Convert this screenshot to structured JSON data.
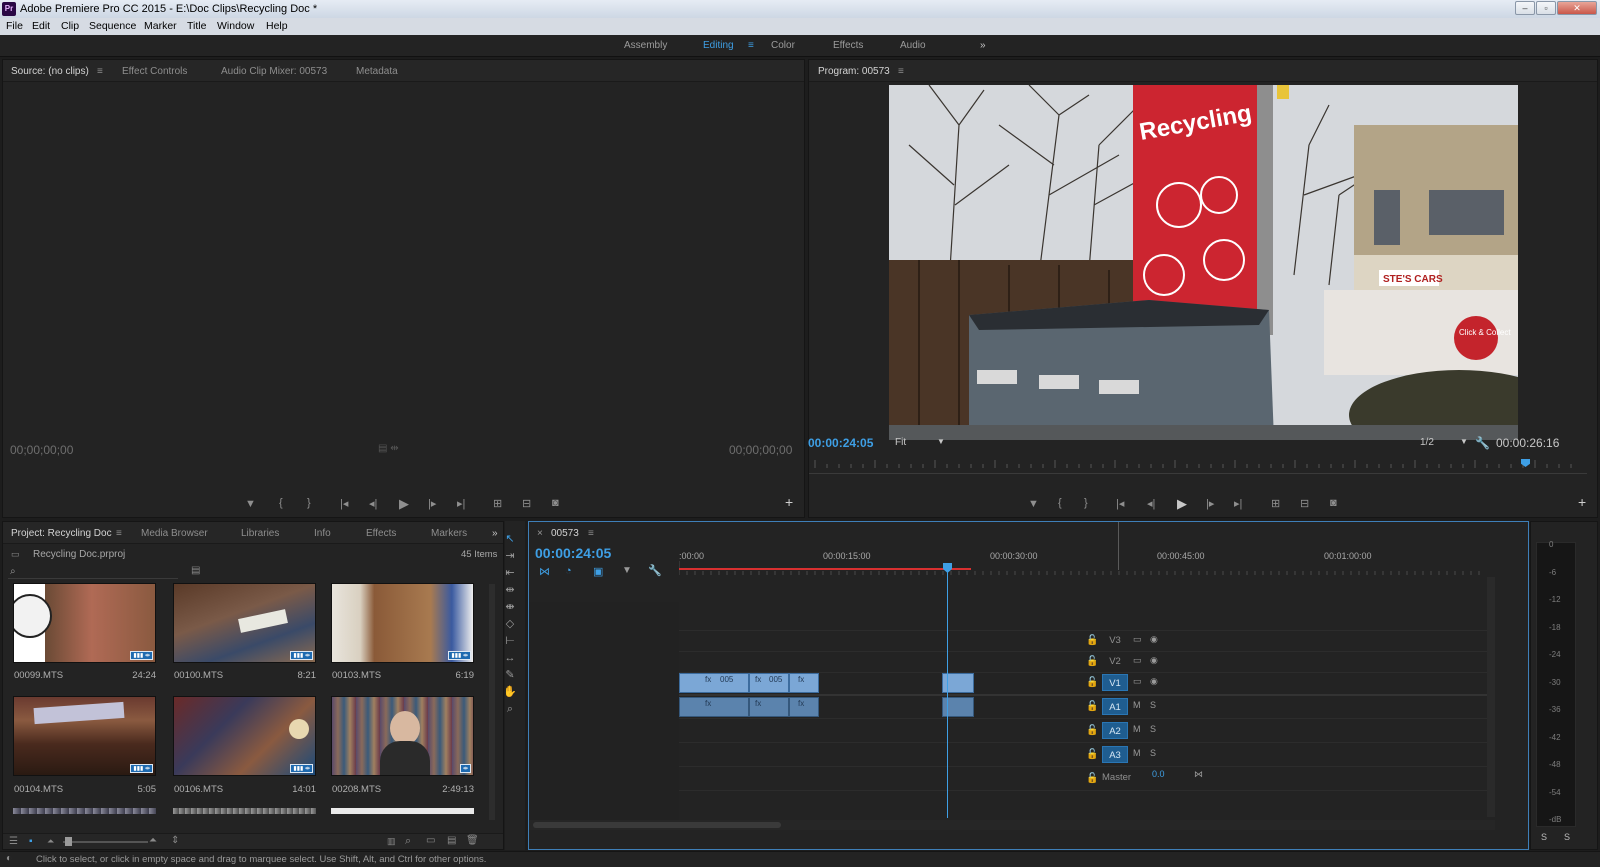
{
  "window": {
    "title": "Adobe Premiere Pro CC 2015 - E:\\Doc Clips\\Recycling Doc *",
    "app_badge": "Pr"
  },
  "menu": [
    "File",
    "Edit",
    "Clip",
    "Sequence",
    "Marker",
    "Title",
    "Window",
    "Help"
  ],
  "workspaces": {
    "items": [
      "Assembly",
      "Editing",
      "Color",
      "Effects",
      "Audio"
    ],
    "active": "Editing",
    "more": "»"
  },
  "source_panel": {
    "tabs": [
      "Source: (no clips)",
      "Effect Controls",
      "Audio Clip Mixer: 00573",
      "Metadata"
    ],
    "timecode_left": "00;00;00;00",
    "timecode_right": "00;00;00;00"
  },
  "program_panel": {
    "tab": "Program: 00573",
    "timecode": "00:00:24:05",
    "zoom": "Fit",
    "resolution": "1/2",
    "duration": "00:00:26:16",
    "sign_text": "Recycling",
    "shop_text": "STE'S CARS",
    "click_collect": "Click & Collect",
    "playhead_fraction": 0.92
  },
  "project_panel": {
    "tabs": [
      "Project: Recycling Doc",
      "Media Browser",
      "Libraries",
      "Info",
      "Effects",
      "Markers"
    ],
    "file": "Recycling Doc.prproj",
    "item_count": "45 Items",
    "clips": [
      {
        "name": "00099.MTS",
        "duration": "24:24"
      },
      {
        "name": "00100.MTS",
        "duration": "8:21"
      },
      {
        "name": "00103.MTS",
        "duration": "6:19"
      },
      {
        "name": "00104.MTS",
        "duration": "5:05"
      },
      {
        "name": "00106.MTS",
        "duration": "14:01"
      },
      {
        "name": "00208.MTS",
        "duration": "2:49:13"
      }
    ]
  },
  "timeline": {
    "tab": "00573",
    "timecode": "00:00:24:05",
    "ruler": [
      ":00:00",
      "00:00:15:00",
      "00:00:30:00",
      "00:00:45:00",
      "00:01:00:00"
    ],
    "tracks": [
      {
        "name": "V3",
        "i1": "▭",
        "i2": "◉"
      },
      {
        "name": "V2",
        "i1": "▭",
        "i2": "◉"
      },
      {
        "name": "V1",
        "i1": "▭",
        "i2": "◉"
      },
      {
        "name": "A1",
        "i1": "M",
        "i2": "S"
      },
      {
        "name": "A2",
        "i1": "M",
        "i2": "S"
      },
      {
        "name": "A3",
        "i1": "M",
        "i2": "S"
      }
    ],
    "master": {
      "label": "Master",
      "value": "0.0"
    },
    "clip_labels": [
      "005",
      "005"
    ]
  },
  "meter": {
    "labels": [
      "0",
      "-6",
      "-12",
      "-18",
      "-24",
      "-30",
      "-36",
      "-42",
      "-48",
      "-54",
      "-dB"
    ],
    "solo": [
      "S",
      "S"
    ]
  },
  "status": "Click to select, or click in empty space and drag to marquee select. Use Shift, Alt, and Ctrl for other options."
}
